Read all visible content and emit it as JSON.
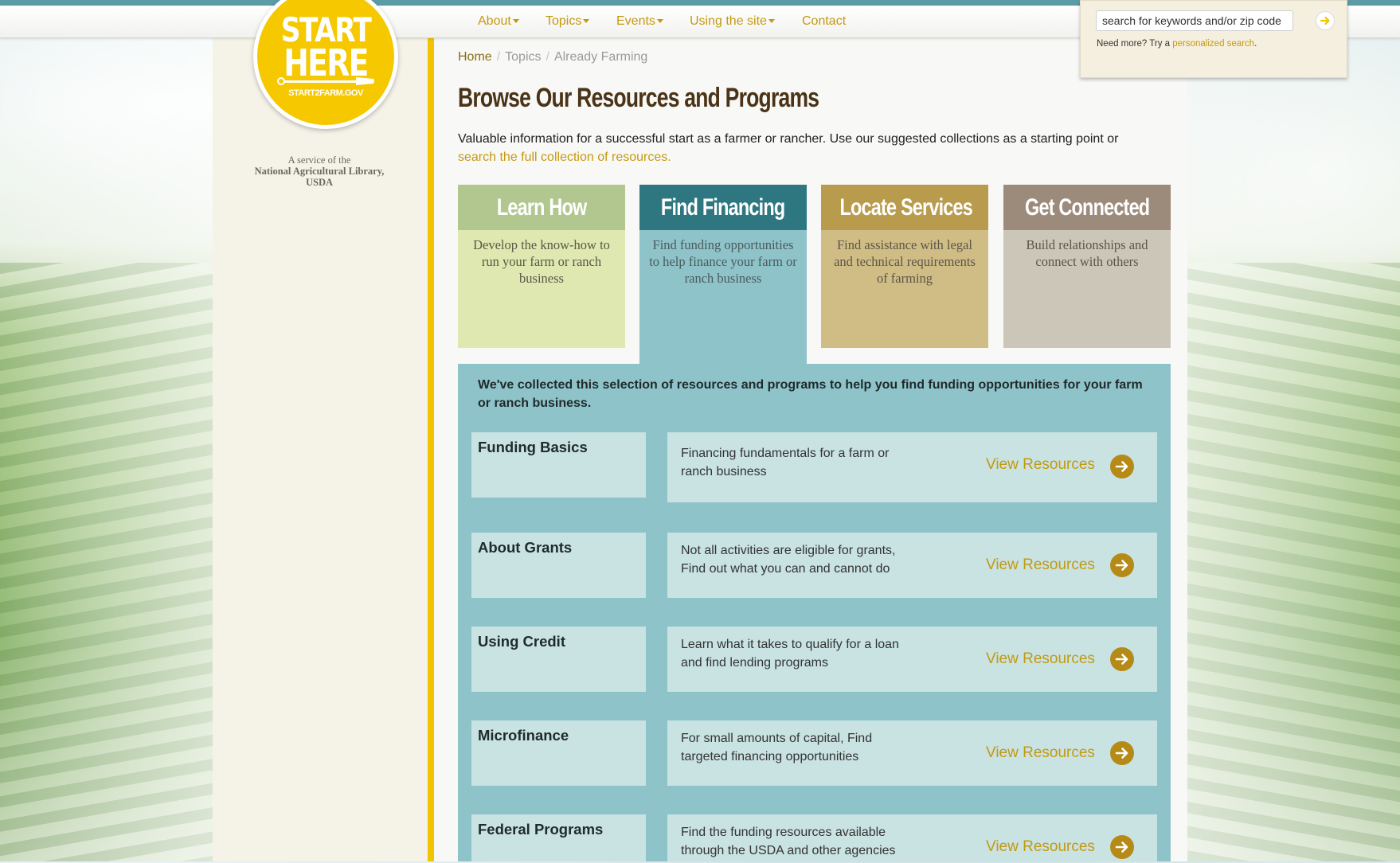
{
  "nav": {
    "items": [
      {
        "label": "About",
        "dropdown": true
      },
      {
        "label": "Topics",
        "dropdown": true
      },
      {
        "label": "Events",
        "dropdown": true
      },
      {
        "label": "Using the site",
        "dropdown": true
      },
      {
        "label": "Contact",
        "dropdown": false
      }
    ]
  },
  "logo": {
    "line1": "START",
    "line2": "HERE",
    "url_text": "START2FARM.GOV"
  },
  "service": {
    "line1": "A service of the",
    "line2": "National Agricultural Library,",
    "line3": "USDA"
  },
  "search": {
    "value": "search for keywords and/or zip code",
    "note_prefix": "Need more? Try a",
    "note_link": "personalized search",
    "note_suffix": "."
  },
  "breadcrumb": {
    "home": "Home",
    "topics": "Topics",
    "current": "Already Farming"
  },
  "page": {
    "title": "Browse Our Resources and Programs",
    "intro_text": "Valuable information for a successful start as a farmer or rancher. Use our suggested collections as a starting point or",
    "intro_link": "search the full collection of resources."
  },
  "tabs": [
    {
      "title": "Learn How",
      "desc": "Develop the know-how to run your farm or ranch business",
      "head_color": "#b2c790",
      "body_color": "#dfe8b0"
    },
    {
      "title": "Find Financing",
      "desc": "Find funding opportunities to help finance your farm or ranch business",
      "head_color": "#2e7780",
      "body_color": "#8fc3ca",
      "active": true
    },
    {
      "title": "Locate Services",
      "desc": "Find assistance with legal and technical requirements of farming",
      "head_color": "#b89b4d",
      "body_color": "#d0bd86"
    },
    {
      "title": "Get Connected",
      "desc": "Build relationships and connect with others",
      "head_color": "#9c8b7b",
      "body_color": "#ccc6b8"
    }
  ],
  "panel": {
    "intro": "We've collected this selection of resources and programs to help you find funding opportunities for your farm or ranch business.",
    "rows": [
      {
        "name": "Funding Basics",
        "desc": "Financing fundamentals for a farm or ranch business",
        "link": "View Resources"
      },
      {
        "name": "About Grants",
        "desc": "Not all activities are eligible for grants, Find out what you can and cannot do",
        "link": "View Resources"
      },
      {
        "name": "Using Credit",
        "desc": "Learn what it takes to qualify for a loan and find lending programs",
        "link": "View Resources"
      },
      {
        "name": "Microfinance",
        "desc": "For small amounts of capital, Find targeted financing opportunities",
        "link": "View Resources"
      },
      {
        "name": "Federal Programs",
        "desc": "Find the funding resources available through the USDA and other agencies",
        "link": "View Resources"
      }
    ]
  },
  "colors": {
    "accent": "#c39a12",
    "gold_bar": "#f2c300",
    "panel": "#8fc3ca",
    "title": "#4a3317"
  }
}
